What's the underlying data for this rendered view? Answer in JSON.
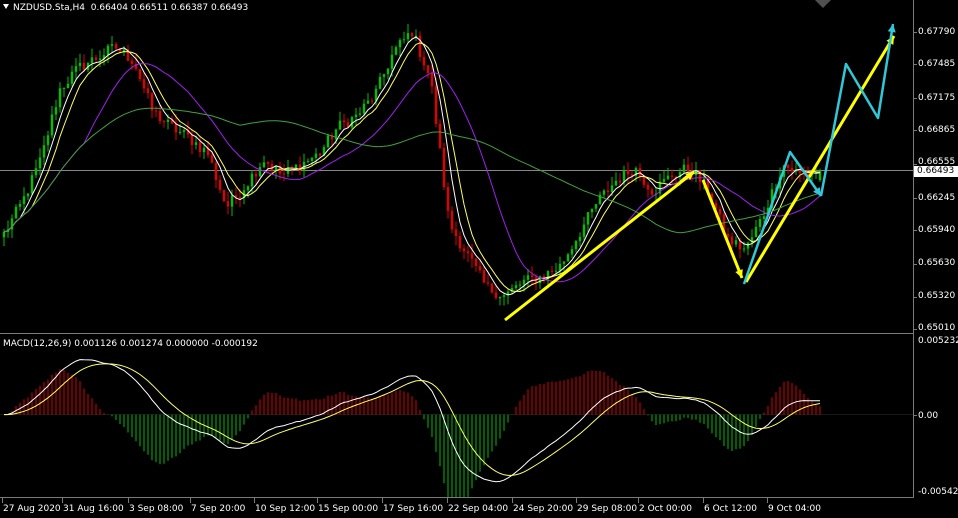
{
  "window": {
    "symbol": "NZDUSD.Sta,H4",
    "ohlc": "0.66404 0.66511 0.66387 0.66493"
  },
  "macd": {
    "label": "MACD(12,26,9) 0.001126 0.001274 0.000000 -0.000192",
    "levels": [
      "0.005232",
      "0.00",
      "-0.005425"
    ]
  },
  "price_axis": [
    "0.67790",
    "0.67485",
    "0.67175",
    "0.66865",
    "0.66555",
    "0.66245",
    "0.65940",
    "0.65630",
    "0.65320",
    "0.65010"
  ],
  "current_price": "0.66493",
  "time_axis": [
    "27 Aug 2020",
    "31 Aug 16:00",
    "3 Sep 08:00",
    "7 Sep 20:00",
    "10 Sep 12:00",
    "15 Sep 00:00",
    "17 Sep 16:00",
    "22 Sep 04:00",
    "24 Sep 20:00",
    "29 Sep 08:00",
    "2 Oct 00:00",
    "6 Oct 12:00",
    "9 Oct 04:00"
  ],
  "colors": {
    "background": "#000000",
    "bull": "#00c000",
    "bear": "#e00000",
    "ma_fast": "#ffffff",
    "ma_yellow": "#ffff66",
    "ma_purple": "#a020f0",
    "ma_slow": "#40a040",
    "annotation_yellow": "#ffff00",
    "annotation_cyan": "#30c8d8"
  },
  "chart_data": {
    "type": "candlestick",
    "symbol": "NZDUSD.Sta",
    "timeframe": "H4",
    "close_path": [
      0.659,
      0.662,
      0.666,
      0.6725,
      0.6745,
      0.6755,
      0.6765,
      0.6752,
      0.6705,
      0.669,
      0.668,
      0.6665,
      0.6615,
      0.6635,
      0.666,
      0.6645,
      0.6655,
      0.6665,
      0.669,
      0.67,
      0.672,
      0.676,
      0.678,
      0.6735,
      0.66,
      0.657,
      0.654,
      0.6532,
      0.6545,
      0.655,
      0.656,
      0.659,
      0.662,
      0.664,
      0.6652,
      0.663,
      0.6645,
      0.6652,
      0.663,
      0.6585,
      0.6575,
      0.661,
      0.6655,
      0.6645,
      0.665
    ],
    "last": {
      "open": 0.66404,
      "high": 0.66511,
      "low": 0.66387,
      "close": 0.66493
    },
    "indicator": {
      "name": "MACD(12,26,9)",
      "values": [
        0.001126,
        0.001274,
        0.0,
        -0.000192
      ]
    }
  }
}
